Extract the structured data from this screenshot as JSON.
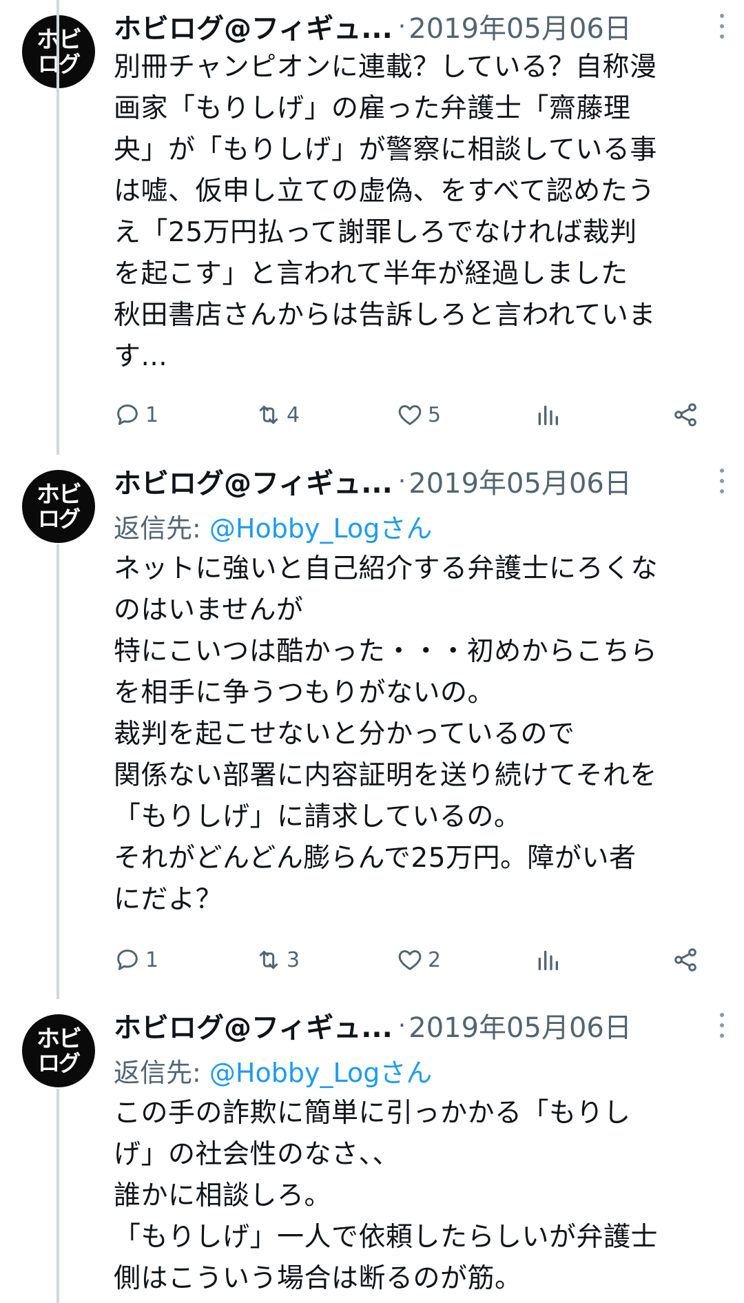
{
  "tweets": [
    {
      "avatar": {
        "line1": "ホビ",
        "line2": "ログ"
      },
      "name": "ホビログ@フィギュ...",
      "separator": "·",
      "date": "2019年05月06日",
      "reply_prefix": "",
      "reply_handle": "",
      "body": "別冊チャンピオンに連載？している？自称漫\n画家「もりしげ」の雇った弁護士「齋藤理\n央」が「もりしげ」が警察に相談している事\nは嘘、仮申し立ての虚偽、をすべて認めたう\nえ「25万円払って謝罪しろでなければ裁判\nを起こす」と言われて半年が経過しました\n秋田書店さんからは告訴しろと言われていま\nす...",
      "replies": "1",
      "retweets": "4",
      "likes": "5"
    },
    {
      "avatar": {
        "line1": "ホビ",
        "line2": "ログ"
      },
      "name": "ホビログ@フィギュ...",
      "separator": "·",
      "date": "2019年05月06日",
      "reply_prefix": "返信先: ",
      "reply_handle": "@Hobby_Logさん",
      "body": "ネットに強いと自己紹介する弁護士にろくな\nのはいませんが\n特にこいつは酷かった・・・初めからこちら\nを相手に争うつもりがないの。\n裁判を起こせないと分かっているので\n関係ない部署に内容証明を送り続けてそれを\n「もりしげ」に請求しているの。\nそれがどんどん膨らんで25万円。障がい者\nにだよ？",
      "replies": "1",
      "retweets": "3",
      "likes": "2"
    },
    {
      "avatar": {
        "line1": "ホビ",
        "line2": "ログ"
      },
      "name": "ホビログ@フィギュ...",
      "separator": "·",
      "date": "2019年05月06日",
      "reply_prefix": "返信先: ",
      "reply_handle": "@Hobby_Logさん",
      "body": "この手の詐欺に簡単に引っかかる「もりし\nげ」の社会性のなさ、、\n誰かに相談しろ。\n「もりしげ」一人で依頼したらしいが弁護士\n側はこういう場合は断るのが筋。"
    }
  ],
  "colors": {
    "text": "#0f1419",
    "secondary": "#536471",
    "link": "#1d9bf0",
    "thread": "#cfd9de"
  },
  "icons": [
    "reply-icon",
    "retweet-icon",
    "like-icon",
    "views-icon",
    "share-icon",
    "more-icon"
  ]
}
